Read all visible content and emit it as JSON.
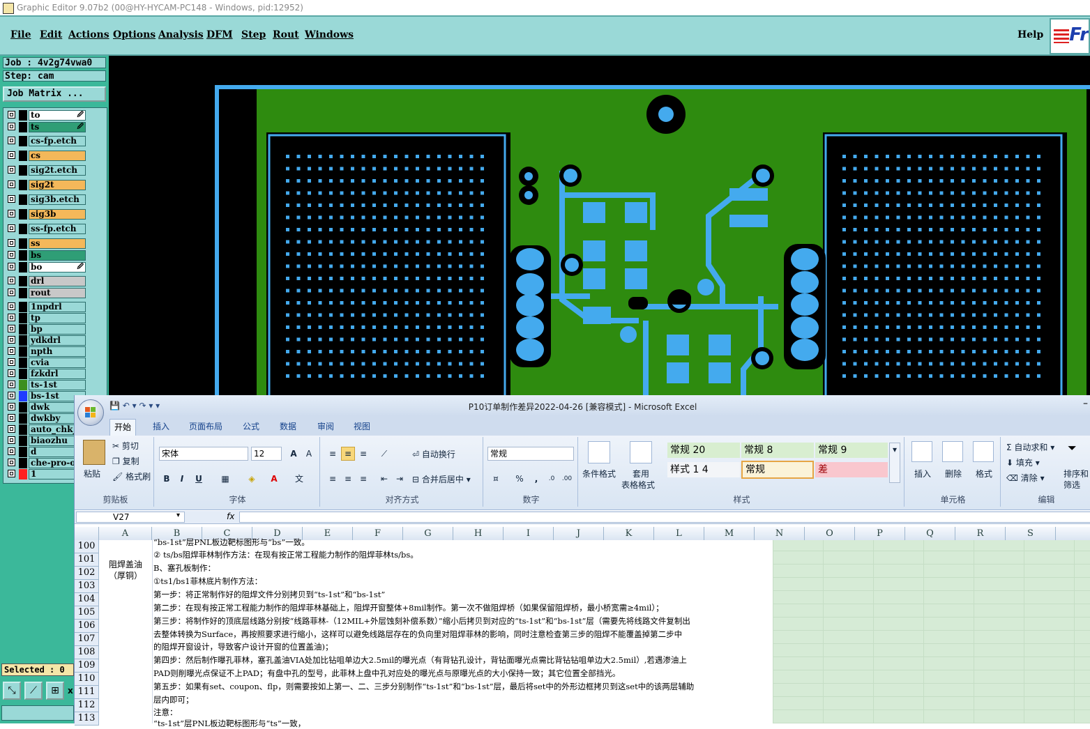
{
  "ge": {
    "title": "Graphic Editor 9.07b2 (00@HY-HYCAM-PC148 - Windows, pid:12952)",
    "menus": [
      "File",
      "Edit",
      "Actions",
      "Options",
      "Analysis",
      "DFM",
      "Step",
      "Rout",
      "Windows"
    ],
    "help": "Help",
    "logo": "Fr",
    "job": "Job : 4v2g74vwa0",
    "step": "Step: cam",
    "job_matrix": "Job Matrix ...",
    "selected": "Selected : 0",
    "layers": [
      {
        "name": "to",
        "color": "#ffffff",
        "swatch": "#000000",
        "mark": true
      },
      {
        "name": "ts",
        "color": "#2f9e76",
        "swatch": "#000000",
        "mark": true
      },
      {
        "name": "cs-fp.etch",
        "color": "#9ad9d7",
        "swatch": "#000000"
      },
      {
        "name": "cs",
        "color": "#f4b85a",
        "swatch": "#000000"
      },
      {
        "name": "sig2t.etch",
        "color": "#9ad9d7",
        "swatch": "#000000"
      },
      {
        "name": "sig2t",
        "color": "#f4b85a",
        "swatch": "#000000"
      },
      {
        "name": "sig3b.etch",
        "color": "#9ad9d7",
        "swatch": "#000000"
      },
      {
        "name": "sig3b",
        "color": "#f4b85a",
        "swatch": "#000000"
      },
      {
        "name": "ss-fp.etch",
        "color": "#9ad9d7",
        "swatch": "#000000"
      },
      {
        "name": "ss",
        "color": "#f4b85a",
        "swatch": "#000000"
      },
      {
        "name": "bs",
        "color": "#2f9e76",
        "swatch": "#000000"
      },
      {
        "name": "bo",
        "color": "#ffffff",
        "swatch": "#000000",
        "mark": true
      },
      {
        "name": "drl",
        "color": "#c8c8c8",
        "swatch": "#000000"
      },
      {
        "name": "rout",
        "color": "#c8c8c8",
        "swatch": "#000000"
      },
      {
        "name": "1npdrl",
        "color": "#9ad9d7",
        "swatch": "#000000"
      },
      {
        "name": "tp",
        "color": "#9ad9d7",
        "swatch": "#000000"
      },
      {
        "name": "bp",
        "color": "#9ad9d7",
        "swatch": "#000000"
      },
      {
        "name": "ydkdrl",
        "color": "#9ad9d7",
        "swatch": "#000000"
      },
      {
        "name": "npth",
        "color": "#9ad9d7",
        "swatch": "#000000"
      },
      {
        "name": "cvia",
        "color": "#9ad9d7",
        "swatch": "#000000"
      },
      {
        "name": "fzkdrl",
        "color": "#9ad9d7",
        "swatch": "#000000"
      },
      {
        "name": "ts-1st",
        "color": "#9ad9d7",
        "swatch": "#3c8f1e"
      },
      {
        "name": "bs-1st",
        "color": "#9ad9d7",
        "swatch": "#1f3cff"
      },
      {
        "name": "dwk",
        "color": "#9ad9d7",
        "swatch": "#000000"
      },
      {
        "name": "dwkby",
        "color": "#9ad9d7",
        "swatch": "#000000"
      },
      {
        "name": "auto_chk_",
        "color": "#9ad9d7",
        "swatch": "#000000"
      },
      {
        "name": "biaozhu",
        "color": "#9ad9d7",
        "swatch": "#000000"
      },
      {
        "name": "d",
        "color": "#9ad9d7",
        "swatch": "#000000"
      },
      {
        "name": "che-pro-o",
        "color": "#9ad9d7",
        "swatch": "#000000"
      },
      {
        "name": "1",
        "color": "#9ad9d7",
        "swatch": "#ff2020"
      }
    ],
    "tool_extra": "x"
  },
  "excel": {
    "title": "P10订单制作差异2022-04-26  [兼容模式] - Microsoft Excel",
    "tabs": [
      "开始",
      "插入",
      "页面布局",
      "公式",
      "数据",
      "审阅",
      "视图"
    ],
    "ribbon": {
      "paste": "粘贴",
      "cut": "剪切",
      "copy": "复制",
      "format_painter": "格式刷",
      "clipboard": "剪贴板",
      "font_name": "宋体",
      "font_size": "12",
      "font_group": "字体",
      "wrap": "自动换行",
      "merge": "合并后居中",
      "align_group": "对齐方式",
      "number_format": "常规",
      "percent": "%",
      "comma": ",",
      "number_group": "数字",
      "cond_format": "条件格式",
      "table_format_1": "套用",
      "table_format_2": "表格格式",
      "styles": [
        "常规 20",
        "常规 8",
        "常规 9",
        "样式 1 4",
        "常规",
        "差"
      ],
      "styles_group": "样式",
      "insert": "插入",
      "delete": "删除",
      "format": "格式",
      "cells_group": "单元格",
      "autosum": "自动求和",
      "fill": "填充",
      "clear": "清除",
      "sort_1": "排序和",
      "sort_2": "筛选",
      "edit_group": "编辑"
    },
    "name_box": "V27",
    "fx": "fx",
    "columns": [
      "A",
      "B",
      "C",
      "D",
      "E",
      "F",
      "G",
      "H",
      "I",
      "J",
      "K",
      "L",
      "M",
      "N",
      "O",
      "P",
      "Q",
      "R",
      "S"
    ],
    "row_numbers": [
      "100",
      "101",
      "102",
      "103",
      "104",
      "105",
      "106",
      "107",
      "108",
      "109",
      "110",
      "111",
      "112",
      "113"
    ],
    "a_cell": [
      "阻焊盖油",
      "（厚铜）"
    ],
    "lines": [
      "“bs-1st”层PNL板边靶标图形与“bs”一致。",
      "② ts/bs阻焊菲林制作方法：在现有按正常工程能力制作的阻焊菲林ts/bs。",
      "B、塞孔板制作：",
      "①ts1/bs1菲林底片制作方法：",
      "第一步：将正常制作好的阻焊文件分别拷贝到“ts-1st”和“bs-1st”",
      "第二步：在现有按正常工程能力制作的阻焊菲林基础上，阻焊开窗整体+8mil制作。第一次不做阻焊桥（如果保留阻焊桥，最小桥宽需≥4mil）；",
      "第三步：将制作好的顶底层线路分别按“线路菲林-（12MIL+外层蚀刻补偿系数）”缩小后拷贝到对应的“ts-1st”和“bs-1st”层（需要先将线路文件复制出",
      "去整体转换为Surface，再按照要求进行缩小，这样可以避免线路层存在的负向里对阻焊菲林的影响，同时注意检查第三步的阻焊不能覆盖掉第二步中",
      "的阻焊开窗设计，导致客户设计开窗的位置盖油)；",
      "第四步：然后制作曝孔菲林，塞孔盖油VIA处加比钻咀单边大2.5mil的曝光点（有背钻孔设计，背钻面曝光点需比背钻钻咀单边大2.5mil）,若遇渗油上",
      "PAD则削曝光点保证不上PAD；有盘中孔的型号，此菲林上盘中孔对应处的曝光点与原曝光点的大小保持一致；其它位置全部挡光。",
      "第五步：如果有set、coupon、flp，则需要按如上第一、二、三步分别制作“ts-1st”和“bs-1st”层，最后将set中的外形边框拷贝到这set中的该两层辅助",
      "层内即可；",
      "注意：",
      "“ts-1st”层PNL板边靶标图形与“ts”一致，"
    ]
  }
}
